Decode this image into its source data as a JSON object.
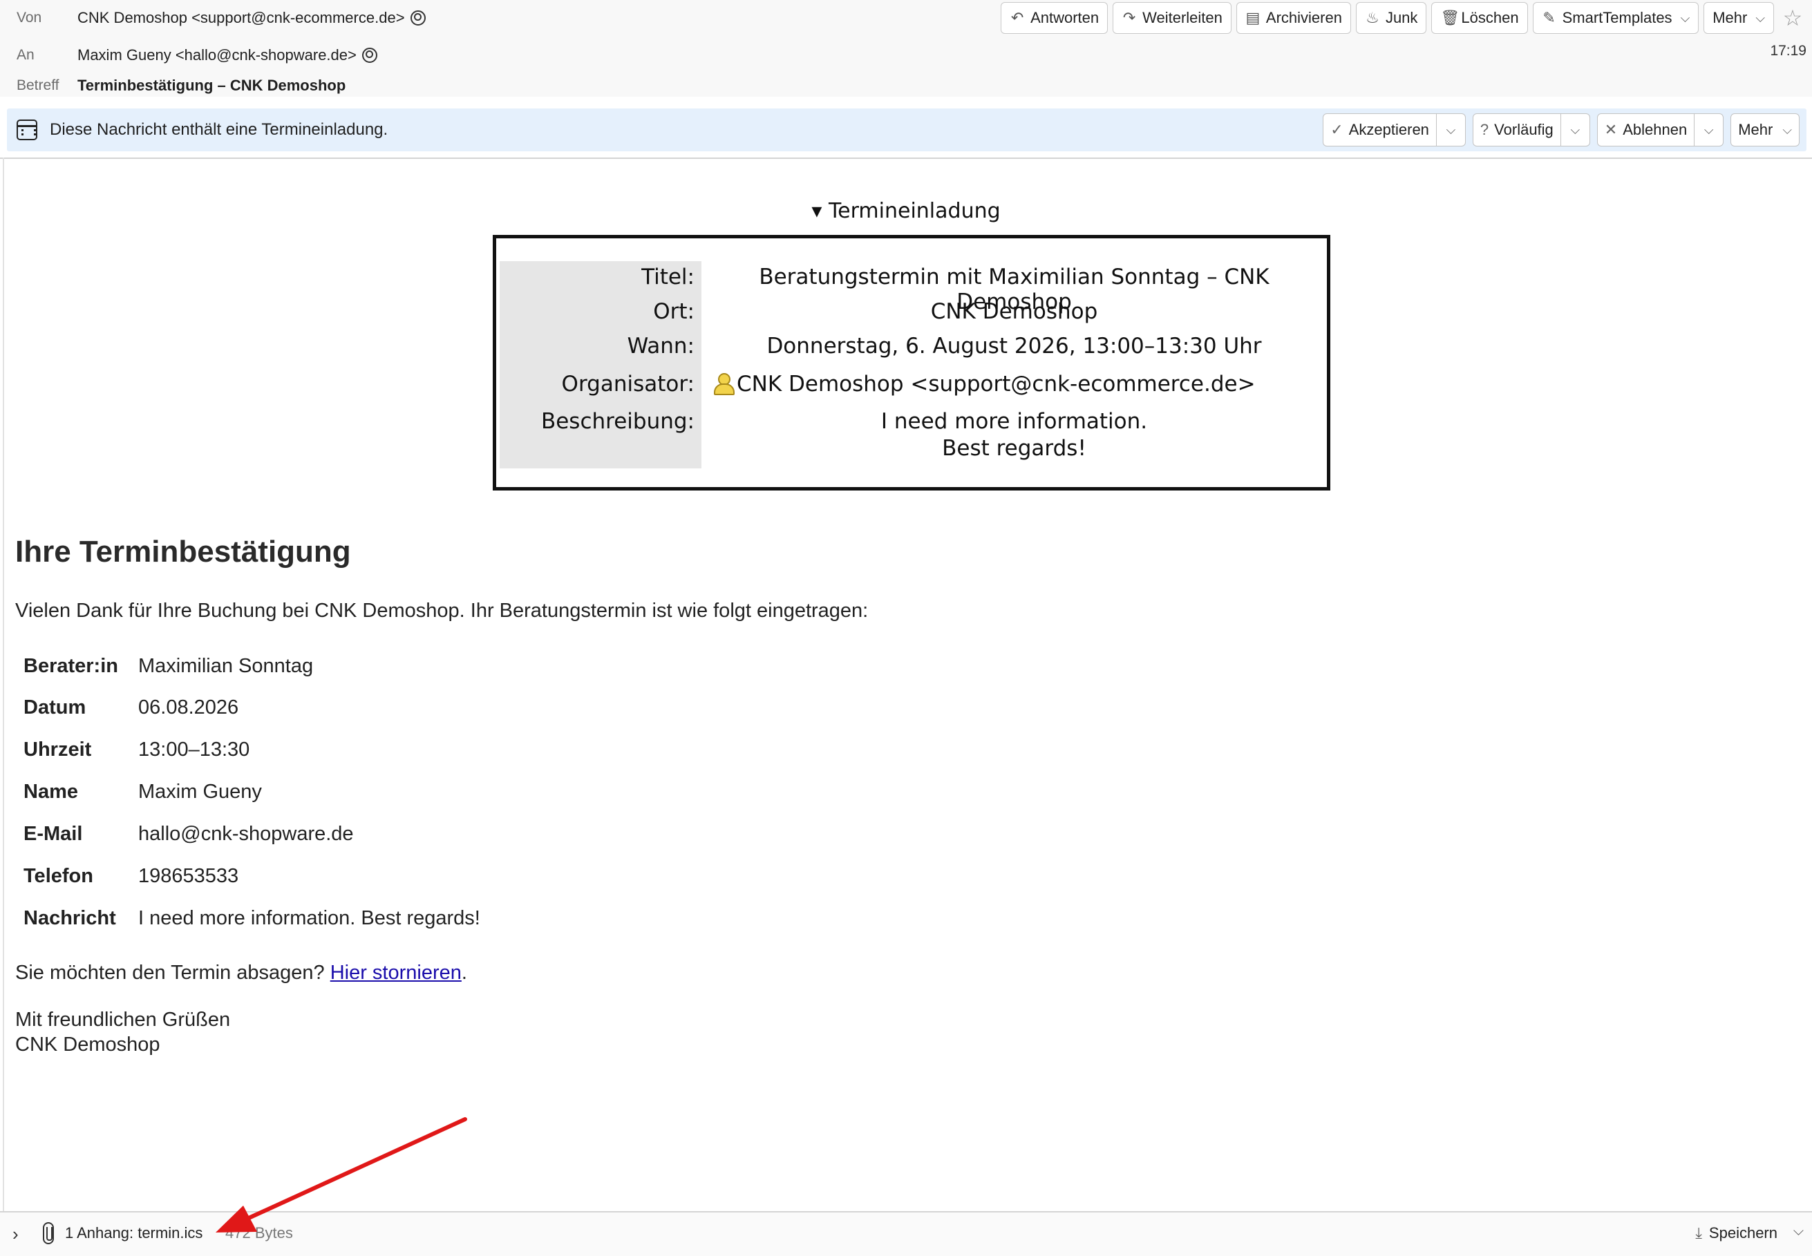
{
  "header": {
    "from_label": "Von",
    "from_value": "CNK Demoshop <support@cnk-ecommerce.de>",
    "to_label": "An",
    "to_value": "Maxim Gueny <hallo@cnk-shopware.de>",
    "subject_label": "Betreff",
    "subject_value": "Terminbestätigung – CNK Demoshop",
    "time": "17:19",
    "toolbar": {
      "reply": "Antworten",
      "forward": "Weiterleiten",
      "archive": "Archivieren",
      "junk": "Junk",
      "delete": "Löschen",
      "smarttemplates": "SmartTemplates",
      "more": "Mehr"
    }
  },
  "notification": {
    "text": "Diese Nachricht enthält eine Termineinladung.",
    "accept": "Akzeptieren",
    "tentative": "Vorläufig",
    "decline": "Ablehnen",
    "more": "Mehr"
  },
  "invitation": {
    "heading": "▾ Termineinladung",
    "title_label": "Titel:",
    "title_value": "Beratungstermin mit Maximilian Sonntag – CNK Demoshop",
    "location_label": "Ort:",
    "location_value": "CNK Demoshop",
    "when_label": "Wann:",
    "when_value": "Donnerstag, 6. August 2026, 13:00–13:30 Uhr",
    "organizer_label": "Organisator:",
    "organizer_value": "CNK Demoshop <support@cnk-ecommerce.de>",
    "description_label": "Beschreibung:",
    "description_line1": "I need more information.",
    "description_line2": "Best regards!"
  },
  "body": {
    "heading": "Ihre Terminbestätigung",
    "intro": "Vielen Dank für Ihre Buchung bei CNK Demoshop. Ihr Beratungstermin ist wie folgt eingetragen:",
    "details": [
      {
        "key": "Berater:in",
        "value": "Maximilian Sonntag"
      },
      {
        "key": "Datum",
        "value": "06.08.2026"
      },
      {
        "key": "Uhrzeit",
        "value": "13:00–13:30"
      },
      {
        "key": "Name",
        "value": "Maxim Gueny"
      },
      {
        "key": "E-Mail",
        "value": "hallo@cnk-shopware.de"
      },
      {
        "key": "Telefon",
        "value": "198653533"
      },
      {
        "key": "Nachricht",
        "value": "I need more information. Best regards!"
      }
    ],
    "cancel_prefix": "Sie möchten den Termin absagen? ",
    "cancel_link": "Hier stornieren",
    "cancel_suffix": ".",
    "closing_line1": "Mit freundlichen Grüßen",
    "closing_line2": "CNK Demoshop"
  },
  "attachment": {
    "label": "1 Anhang: termin.ics",
    "size": "472 Bytes",
    "save": "Speichern"
  },
  "colors": {
    "notification_bg": "#e5f0fc",
    "link": "#1a0dab",
    "annotation_arrow": "#e01818"
  }
}
